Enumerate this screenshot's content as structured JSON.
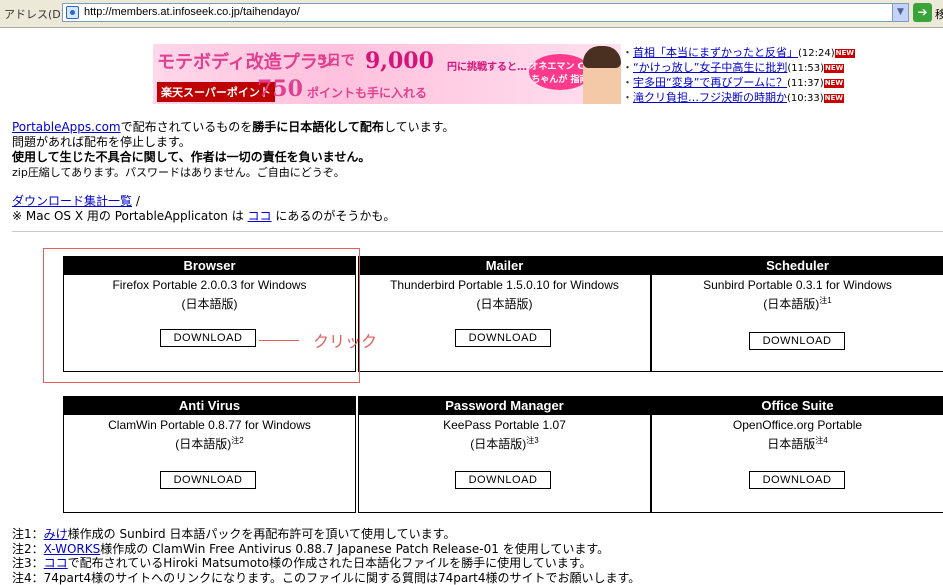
{
  "address_bar": {
    "label": "アドレス(D)",
    "url": "http://members.at.infoseek.co.jp/taihendayo/",
    "go_label": "移"
  },
  "banner": {
    "line1": "モテボディ改造プラン",
    "days": "5日で",
    "amount": "9,000",
    "amount_suffix": "円に挑戦すると…",
    "rakuten": "楽天スーパーポイント",
    "points": "750",
    "points_suffix": "ポイントも手に入れる",
    "badge": "オネエマン CCちゃんが 指南"
  },
  "news": [
    {
      "title": "首相「本当にまずかったと反省」",
      "time": "(12:24)"
    },
    {
      "title": "“かけっ放し”女子中高生に批判",
      "time": "(11:53)"
    },
    {
      "title": "宇多田“変身”で再びブームに？",
      "time": "(11:37)"
    },
    {
      "title": "滝クリ負担…フジ決断の時期か",
      "time": "(10:33)"
    }
  ],
  "news_new_label": "NEW",
  "intro": {
    "line1_link": "PortableApps.com",
    "line1_a": "で配布されているものを",
    "line1_bold": "勝手に日本語化して配布",
    "line1_b": "しています。",
    "line2": "問題があれば配布を停止します。",
    "line3": "使用して生じた不具合に関して、作者は一切の責任を負いません。",
    "line4": "zip圧縮してあります。パスワードはありません。ご自由にどうぞ。"
  },
  "downloads": {
    "link": "ダウンロード集計一覧",
    "slash": " /",
    "mac_a": "※ Mac OS X 用の PortableApplicaton は ",
    "mac_link": "ココ",
    "mac_b": " にあるのがそうかも。"
  },
  "annotation": {
    "click": "クリック"
  },
  "products": [
    {
      "category": "Browser",
      "name": "Firefox Portable 2.0.0.3 for Windows",
      "sub": "(日本語版)",
      "note": "",
      "button": "DOWNLOAD"
    },
    {
      "category": "Mailer",
      "name": "Thunderbird Portable 1.5.0.10 for Windows",
      "sub": "(日本語版)",
      "note": "",
      "button": "DOWNLOAD"
    },
    {
      "category": "Scheduler",
      "name": "Sunbird Portable 0.3.1 for Windows",
      "sub": "(日本語版)",
      "note": "注1",
      "button": "DOWNLOAD"
    },
    {
      "category": "Anti Virus",
      "name": "ClamWin Portable 0.8.77 for Windows",
      "sub": "(日本語版)",
      "note": "注2",
      "button": "DOWNLOAD"
    },
    {
      "category": "Password Manager",
      "name": "KeePass Portable 1.07",
      "sub": "(日本語版)",
      "note": "注3",
      "button": "DOWNLOAD"
    },
    {
      "category": "Office Suite",
      "name": "OpenOffice.org Portable",
      "sub": "日本語版",
      "note": "注4",
      "button": "DOWNLOAD"
    }
  ],
  "notes": [
    {
      "prefix": "注1：",
      "link": "みけ",
      "text": "様作成の Sunbird 日本語パックを再配布許可を頂いて使用しています。"
    },
    {
      "prefix": "注2：",
      "link": "X-WORKS",
      "text": "様作成の ClamWin Free Antivirus 0.88.7 Japanese Patch Release-01 を使用しています。"
    },
    {
      "prefix": "注3：",
      "link": "ココ",
      "text": "で配布されているHiroki Matsumoto様の作成された日本語化ファイルを勝手に使用しています。"
    },
    {
      "prefix": "注4：",
      "link": "",
      "text": "74part4様のサイトへのリンクになります。このファイルに関する質問は74part4様のサイトでお願いします。"
    }
  ]
}
